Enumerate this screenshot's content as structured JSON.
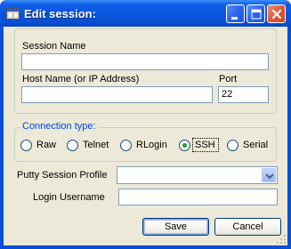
{
  "window": {
    "title": "Edit session:",
    "icon": "app-window-icon",
    "buttons": [
      "minimize-icon",
      "maximize-icon",
      "close-icon"
    ]
  },
  "form": {
    "session_name_label": "Session Name",
    "session_name_value": "",
    "host_label": "Host Name (or IP Address)",
    "host_value": "",
    "port_label": "Port",
    "port_value": "22",
    "connection_type_label": "Connection type:",
    "connection_types": [
      {
        "label": "Raw",
        "selected": false
      },
      {
        "label": "Telnet",
        "selected": false
      },
      {
        "label": "RLogin",
        "selected": false
      },
      {
        "label": "SSH",
        "selected": true
      },
      {
        "label": "Serial",
        "selected": false
      }
    ],
    "profile_label": "Putty Session Profile",
    "profile_value": "",
    "username_label": "Login Username",
    "username_value": ""
  },
  "actions": {
    "save_label": "Save",
    "cancel_label": "Cancel"
  },
  "colors": {
    "titlebar": "#0a4fd8",
    "dialog_bg": "#ece9d8",
    "group_caption": "#0046d5",
    "radio_checked": "#21a121"
  }
}
